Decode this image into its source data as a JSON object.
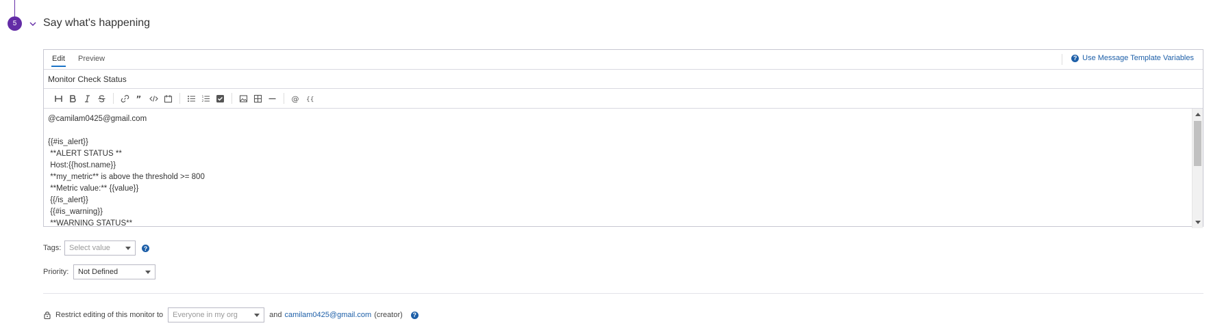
{
  "step": {
    "number": "5",
    "title": "Say what's happening"
  },
  "editor": {
    "tabs": [
      {
        "label": "Edit"
      },
      {
        "label": "Preview"
      }
    ],
    "template_link": "Use Message Template Variables",
    "title_value": "Monitor Check Status",
    "toolbar": [
      "heading-icon",
      "bold-icon",
      "italic-icon",
      "strikethrough-icon",
      "link-icon",
      "quote-icon",
      "code-icon",
      "code-block-icon",
      "bullet-list-icon",
      "numbered-list-icon",
      "checklist-icon",
      "image-icon",
      "table-icon",
      "horizontal-rule-icon",
      "mention-icon",
      "template-variable-icon"
    ],
    "body": "@camilam0425@gmail.com\n\n{{#is_alert}}\n **ALERT STATUS **\n Host:{{host.name}}\n **my_metric** is above the threshold >= 800\n **Metric value:** {{value}}\n {{/is_alert}}\n {{#is_warning}}\n **WARNING STATUS**"
  },
  "tags": {
    "label": "Tags:",
    "placeholder": "Select value"
  },
  "priority": {
    "label": "Priority:",
    "value": "Not Defined"
  },
  "restrict": {
    "prefix": "Restrict editing of this monitor to",
    "select_placeholder": "Everyone in my org",
    "and": "and",
    "email": "camilam0425@gmail.com",
    "suffix": "(creator)"
  },
  "colors": {
    "accent": "#632ca6",
    "link": "#1d5fa8",
    "tab_underline": "#1a73c7"
  }
}
